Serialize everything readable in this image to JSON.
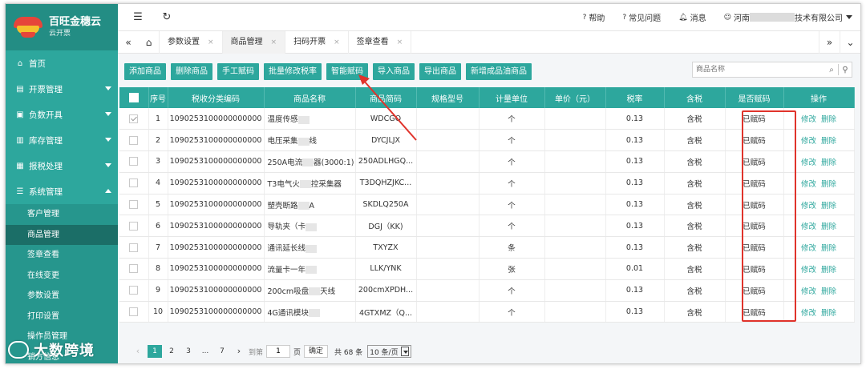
{
  "brand": {
    "title": "百旺金穗云",
    "subtitle": "云开票"
  },
  "sidebar": {
    "items": [
      {
        "label": "首页",
        "icon": "home-icon",
        "glyph": "⌂",
        "expandable": false
      },
      {
        "label": "开票管理",
        "icon": "list-icon",
        "glyph": "▤",
        "expandable": true
      },
      {
        "label": "负数开具",
        "icon": "document-icon",
        "glyph": "▣",
        "expandable": true
      },
      {
        "label": "库存管理",
        "icon": "inventory-icon",
        "glyph": "▥",
        "expandable": true
      },
      {
        "label": "报税处理",
        "icon": "tax-icon",
        "glyph": "▦",
        "expandable": true
      },
      {
        "label": "系统管理",
        "icon": "settings-icon",
        "glyph": "☰",
        "expandable": true,
        "expanded": true
      }
    ],
    "subitems": [
      "客户管理",
      "商品管理",
      "签章查看",
      "在线变更",
      "参数设置",
      "打印设置",
      "操作员管理",
      "销方信息"
    ],
    "active_subitem": "商品管理"
  },
  "topbar": {
    "menu_glyph": "☰",
    "refresh_glyph": "↻",
    "help": "帮助",
    "faq": "常见问题",
    "messages": "消息",
    "company_prefix": "河南",
    "company_suffix": "技术有限公司"
  },
  "tabs": [
    "参数设置",
    "商品管理",
    "扫码开票",
    "签章查看"
  ],
  "active_tab": "商品管理",
  "toolbar": {
    "buttons": [
      "添加商品",
      "删除商品",
      "手工赋码",
      "批量修改税率",
      "智能赋码",
      "导入商品",
      "导出商品",
      "新增成品油商品"
    ]
  },
  "search": {
    "placeholder": "商品名称"
  },
  "table": {
    "headers": [
      "序号",
      "税收分类编码",
      "商品名称",
      "商品简码",
      "规格型号",
      "计量单位",
      "单价（元）",
      "税率",
      "含税",
      "是否赋码",
      "操作"
    ],
    "rows": [
      {
        "no": "1",
        "code": "1090253100000000000",
        "name": "温度传感",
        "short": "WDCGQ",
        "spec": "",
        "unit": "个",
        "price": "",
        "rate": "0.13",
        "tax": "含税",
        "coded": "已赋码",
        "checked": true
      },
      {
        "no": "2",
        "code": "1090253100000000000",
        "name": "电压采集",
        "name_tail": "线",
        "short": "DYCJLJX",
        "spec": "",
        "unit": "个",
        "price": "",
        "rate": "0.13",
        "tax": "含税",
        "coded": "已赋码",
        "checked": false
      },
      {
        "no": "3",
        "code": "1090253100000000000",
        "name": "250A电流",
        "name_tail": "器(3000:1)",
        "short": "250ADLHGQ...",
        "spec": "",
        "unit": "个",
        "price": "",
        "rate": "0.13",
        "tax": "含税",
        "coded": "已赋码",
        "checked": false
      },
      {
        "no": "4",
        "code": "1090253100000000000",
        "name": "T3电气火",
        "name_tail": "控采集器",
        "short": "T3DQHZJKC...",
        "spec": "",
        "unit": "个",
        "price": "",
        "rate": "0.13",
        "tax": "含税",
        "coded": "已赋码",
        "checked": false
      },
      {
        "no": "5",
        "code": "1090253100000000000",
        "name": "塑壳断路",
        "name_tail": "A",
        "short": "SKDLQ250A",
        "spec": "",
        "unit": "个",
        "price": "",
        "rate": "0.13",
        "tax": "含税",
        "coded": "已赋码",
        "checked": false
      },
      {
        "no": "6",
        "code": "1090253100000000000",
        "name": "导轨夹（卡",
        "short": "DGJ（KK)",
        "spec": "",
        "unit": "个",
        "price": "",
        "rate": "0.13",
        "tax": "含税",
        "coded": "已赋码",
        "checked": false
      },
      {
        "no": "7",
        "code": "1090253100000000000",
        "name": "通讯延长线",
        "short": "TXYZX",
        "spec": "",
        "unit": "条",
        "price": "",
        "rate": "0.13",
        "tax": "含税",
        "coded": "已赋码",
        "checked": false
      },
      {
        "no": "8",
        "code": "1090253100000000000",
        "name": "流量卡一年",
        "short": "LLK/YNK",
        "spec": "",
        "unit": "张",
        "price": "",
        "rate": "0.01",
        "tax": "含税",
        "coded": "已赋码",
        "checked": false
      },
      {
        "no": "9",
        "code": "1090253100000000000",
        "name": "200cm吸盘",
        "name_tail": "天线",
        "short": "200cmXPDH...",
        "spec": "",
        "unit": "个",
        "price": "",
        "rate": "0.13",
        "tax": "含税",
        "coded": "已赋码",
        "checked": false
      },
      {
        "no": "10",
        "code": "1090253100000000000",
        "name": "4G通讯模块",
        "short": "4GTXMZ（Q...",
        "spec": "",
        "unit": "个",
        "price": "",
        "rate": "0.13",
        "tax": "含税",
        "coded": "已赋码",
        "checked": false
      }
    ],
    "action_edit": "修改",
    "action_delete": "删除"
  },
  "pagination": {
    "pages": [
      "1",
      "2",
      "3",
      "...",
      "7"
    ],
    "active": "1",
    "goto_label": "到第",
    "goto_value": "1",
    "page_unit": "页",
    "confirm": "确定",
    "total": "共 68 条",
    "per_page": "10 条/页"
  },
  "watermark": "大数跨境",
  "colors": {
    "primary": "#2da79d",
    "highlight": "#e0332b"
  }
}
